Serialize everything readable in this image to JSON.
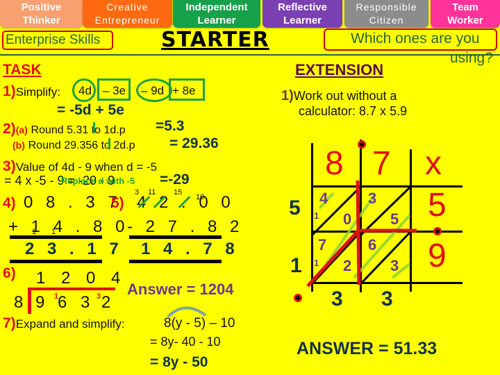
{
  "skills": [
    {
      "line1": "Positive",
      "line2": "Thinker",
      "color": "#f8a070"
    },
    {
      "line1": "Creative",
      "line2": "Entrepreneur",
      "color": "#ff6a10"
    },
    {
      "line1": "Independent",
      "line2": "Learner",
      "color": "#16a04a"
    },
    {
      "line1": "Reflective",
      "line2": "Learner",
      "color": "#7a3fb0"
    },
    {
      "line1": "Responsible",
      "line2": "Citizen",
      "color": "#8c8c8c"
    },
    {
      "line1": "Team",
      "line2": "Worker",
      "color": "#ff3399"
    }
  ],
  "header": {
    "enterprise": "Enterprise Skills",
    "title": "STARTER",
    "prompt_line1": "Which ones are you",
    "prompt_line2": "using?"
  },
  "task": {
    "title": "TASK",
    "q1": {
      "num": "1)",
      "label": "Simplify:",
      "terms": [
        "4d",
        "– 3e",
        "– 9d",
        "+ 8e"
      ],
      "answer": "= -5d + 5e"
    },
    "q2": {
      "num": "2)",
      "a": {
        "label": "(a)",
        "text": "Round 5.31 to 1d.p",
        "answer": "=5.3"
      },
      "b": {
        "label": "(b)",
        "text": "Round 29.356 to 2d.p",
        "answer": "= 29.36"
      }
    },
    "q3": {
      "num": "3)",
      "text": "Value of 4d - 9 when d = -5",
      "working": "= 4 x -5 - 9 = -20 - 9",
      "hint": "Replace d with -5",
      "answer": "=-29"
    },
    "q4": {
      "num": "4)",
      "top": "0 8 . 3 7",
      "bottom": "+ 1 4 . 8 0",
      "carries": [
        "1",
        "1"
      ],
      "result": "2 3 . 1 7"
    },
    "q5": {
      "num": "5)",
      "top": "4 2 . 0 0",
      "carries": [
        "3",
        "11",
        "15",
        "10"
      ],
      "bottom": "- 2 7 . 8 2",
      "result": "1 4 . 7 8"
    },
    "q6": {
      "num": "6)",
      "quotient": "1 2 0 4",
      "divisor": "8",
      "dividend": [
        "9",
        "6",
        "3",
        "2"
      ],
      "carries": [
        "1",
        "3"
      ],
      "answer": "Answer = 1204"
    },
    "q7": {
      "num": "7)",
      "text": "Expand and simplify:",
      "expr": "8(y - 5) – 10",
      "step1": "= 8y- 40 - 10",
      "answer": "= 8y - 50"
    }
  },
  "extension": {
    "title": "EXTENSION",
    "q1": {
      "num": "1)",
      "line1": "Work out without a",
      "line2": "calculator: 8.7 x 5.9"
    },
    "lattice": {
      "top_digits": [
        "8",
        "7"
      ],
      "operator": "x",
      "right_digits": [
        "5",
        "9"
      ],
      "cells": [
        {
          "tens": "4",
          "units": "0",
          "carry": "1"
        },
        {
          "tens": "3",
          "units": "5"
        },
        {
          "tens": "7",
          "units": "2",
          "carry": "1"
        },
        {
          "tens": "6",
          "units": "3"
        }
      ],
      "left_sums": [
        "5",
        "1"
      ],
      "bottom_sums": [
        "3",
        "3"
      ]
    },
    "answer": "ANSWER = 51.33"
  }
}
